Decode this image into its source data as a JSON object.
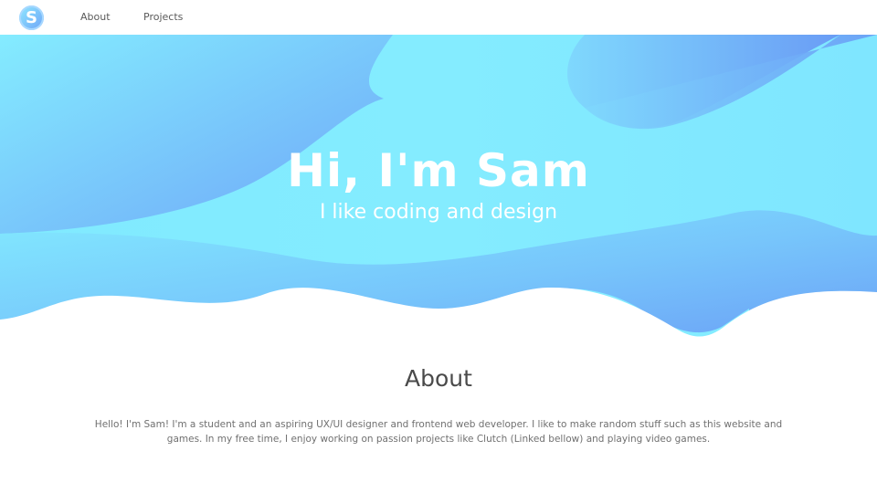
{
  "navbar": {
    "logo_letter": "S",
    "links": [
      {
        "label": "About"
      },
      {
        "label": "Projects"
      }
    ]
  },
  "hero": {
    "title": "Hi, I'm Sam",
    "subtitle": "I like coding and design",
    "colors": {
      "light": "#80ebff",
      "dark": "#6aa2f5"
    }
  },
  "about": {
    "heading": "About",
    "text": "Hello! I'm Sam! I'm a student and an aspiring UX/UI designer and frontend web developer. I like to make random stuff such as this website and games. In my free time, I enjoy working on passion projects like Clutch (Linked bellow) and playing video games."
  }
}
